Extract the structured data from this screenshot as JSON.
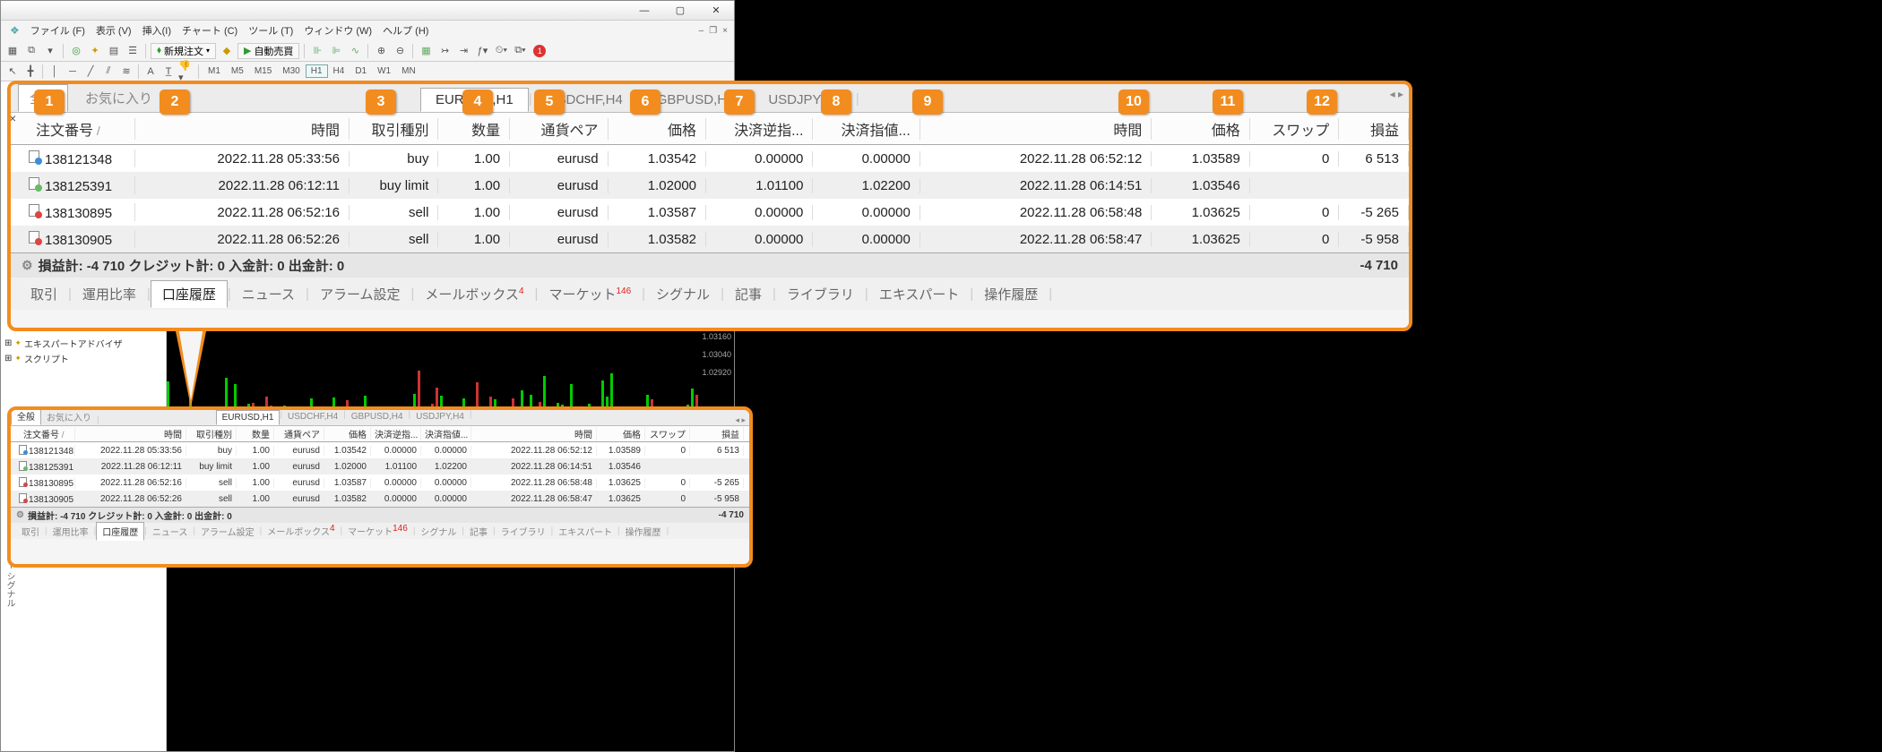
{
  "menus": {
    "file": "ファイル (F)",
    "view": "表示 (V)",
    "insert": "挿入(I)",
    "chart": "チャート (C)",
    "tools": "ツール (T)",
    "window": "ウィンドウ (W)",
    "help": "ヘルプ (H)"
  },
  "toolbar": {
    "new_order": "新規注文",
    "auto": "自動売買",
    "badge": "1"
  },
  "timeframes": [
    "M1",
    "M5",
    "M15",
    "M30",
    "H1",
    "H4",
    "D1",
    "W1",
    "MN"
  ],
  "active_tf": "H1",
  "navigator": {
    "expert": "エキスパートアドバイザ",
    "script": "スクリプト"
  },
  "price_ticks": [
    "1.03160",
    "1.03040",
    "1.02920"
  ],
  "upper_left_tabs": {
    "general": "全般",
    "fav": "お気に入り"
  },
  "chart_tabs": [
    "EURUSD,H1",
    "USDCHF,H4",
    "GBPUSD,H4",
    "USDJPY,H4"
  ],
  "columns": {
    "order": "注文番号",
    "time1": "時間",
    "type": "取引種別",
    "vol": "数量",
    "pair": "通貨ペア",
    "price1": "価格",
    "sl": "決済逆指...",
    "tp": "決済指値...",
    "time2": "時間",
    "price2": "価格",
    "swap": "スワップ",
    "pl": "損益"
  },
  "columns_long": {
    "sl": "決済逆指値",
    "tp": "決済指値"
  },
  "rows": [
    {
      "icon": "b",
      "id": "138121348",
      "t1": "2022.11.28 05:33:56",
      "type": "buy",
      "vol": "1.00",
      "pair": "eurusd",
      "p1": "1.03542",
      "sl": "0.00000",
      "tp": "0.00000",
      "t2": "2022.11.28 06:52:12",
      "p2": "1.03589",
      "swap": "0",
      "pl": "6 513"
    },
    {
      "icon": "g",
      "id": "138125391",
      "t1": "2022.11.28 06:12:11",
      "type": "buy limit",
      "vol": "1.00",
      "pair": "eurusd",
      "p1": "1.02000",
      "sl": "1.01100",
      "tp": "1.02200",
      "t2": "2022.11.28 06:14:51",
      "p2": "1.03546",
      "swap": "",
      "pl": ""
    },
    {
      "icon": "r",
      "id": "138130895",
      "t1": "2022.11.28 06:52:16",
      "type": "sell",
      "vol": "1.00",
      "pair": "eurusd",
      "p1": "1.03587",
      "sl": "0.00000",
      "tp": "0.00000",
      "t2": "2022.11.28 06:58:48",
      "p2": "1.03625",
      "swap": "0",
      "pl": "-5 265"
    },
    {
      "icon": "r",
      "id": "138130905",
      "t1": "2022.11.28 06:52:26",
      "type": "sell",
      "vol": "1.00",
      "pair": "eurusd",
      "p1": "1.03582",
      "sl": "0.00000",
      "tp": "0.00000",
      "t2": "2022.11.28 06:58:47",
      "p2": "1.03625",
      "swap": "0",
      "pl": "-5 958"
    }
  ],
  "summary": {
    "text": "損益計: -4 710  クレジット計: 0  入金計: 0  出金計: 0",
    "right": "-4 710"
  },
  "bottom_tabs": {
    "trade": "取引",
    "ratio": "運用比率",
    "history": "口座履歴",
    "news": "ニュース",
    "alarm": "アラーム設定",
    "mail": "メールボックス",
    "mail_badge": "4",
    "market": "マーケット",
    "market_badge": "146",
    "signal": "シグナル",
    "article": "記事",
    "library": "ライブラリ",
    "expert": "エキスパート",
    "log": "操作履歴"
  },
  "markers": [
    "1",
    "2",
    "3",
    "4",
    "5",
    "6",
    "7",
    "8",
    "9",
    "10",
    "11",
    "12"
  ]
}
